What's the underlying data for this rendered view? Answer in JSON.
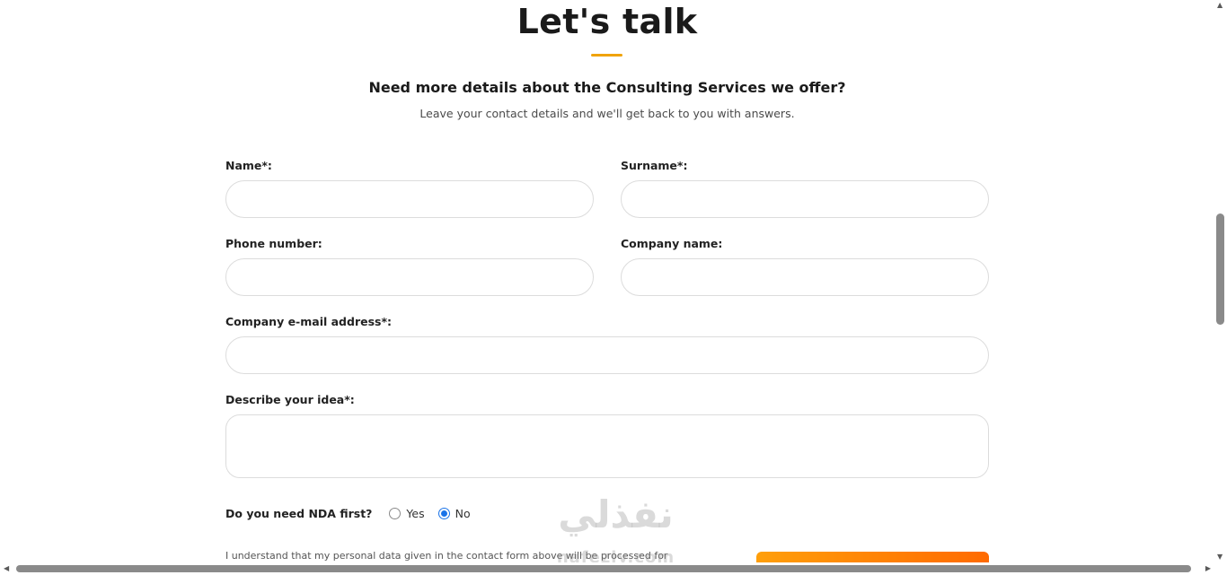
{
  "header": {
    "title": "Let's talk",
    "headline": "Need more details about the Consulting Services we offer?",
    "subline": "Leave your contact details and we'll get back to you with answers.",
    "accent_color": "#f0a30a"
  },
  "form": {
    "name_label": "Name*:",
    "name_value": "",
    "surname_label": "Surname*:",
    "surname_value": "",
    "phone_label": "Phone number:",
    "phone_value": "",
    "company_label": "Company name:",
    "company_value": "",
    "email_label": "Company e-mail address*:",
    "email_value": "",
    "idea_label": "Describe your idea*:",
    "idea_value": "",
    "nda_question": "Do you need NDA first?",
    "nda_options": [
      "Yes",
      "No"
    ],
    "nda_selected": "No",
    "consent_text": "I understand that my personal data given in the contact form above will be processed for",
    "submit_gradient": [
      "#ff9f0a",
      "#ff6a00"
    ]
  },
  "watermark": {
    "arabic": "نفذلي",
    "latin": "nafezly.com"
  },
  "icons": {
    "scroll_up": "triangle-up-icon",
    "scroll_down": "triangle-down-icon",
    "scroll_left": "triangle-left-icon",
    "scroll_right": "triangle-right-icon"
  }
}
